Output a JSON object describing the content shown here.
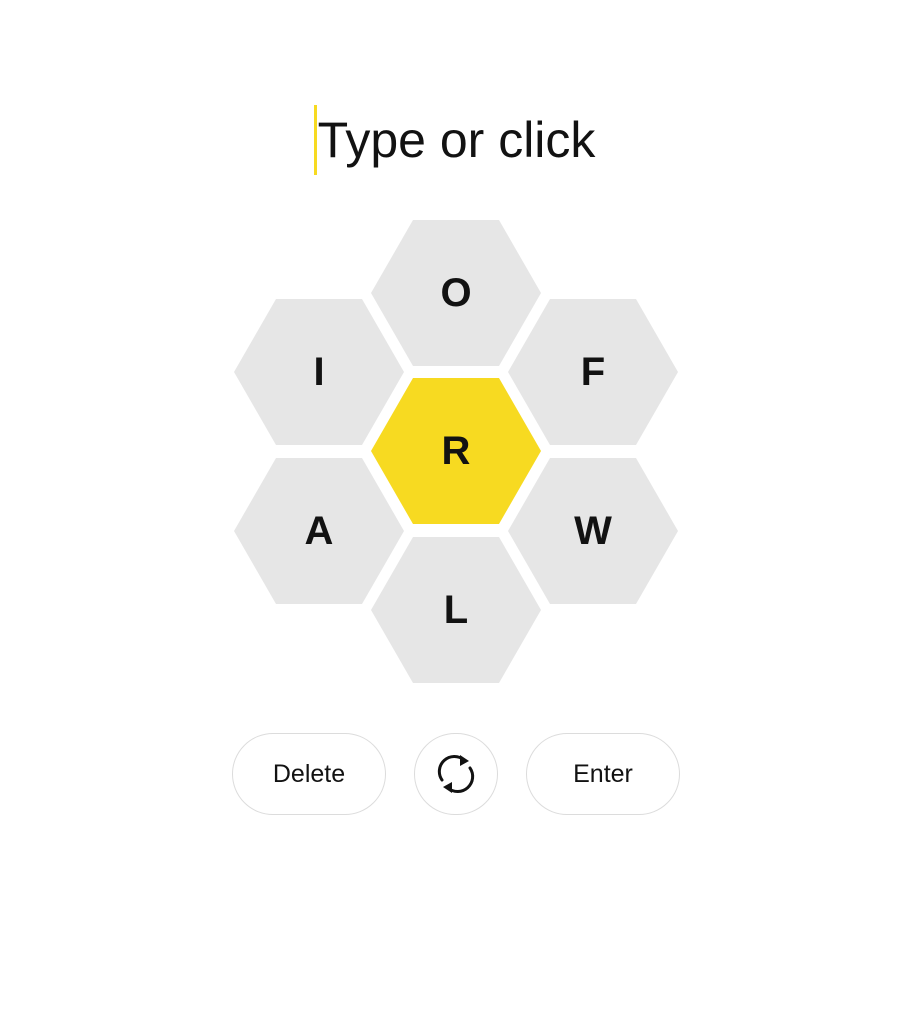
{
  "input": {
    "placeholder": "Type or click",
    "caret_color": "#f7da21"
  },
  "hive": {
    "center_color": "#f7da21",
    "outer_color": "#e6e6e6",
    "letter_color": "#121212",
    "center": {
      "letter": "R"
    },
    "outer": [
      {
        "position": "top",
        "letter": "O"
      },
      {
        "position": "upper-left",
        "letter": "I"
      },
      {
        "position": "upper-right",
        "letter": "F"
      },
      {
        "position": "lower-left",
        "letter": "A"
      },
      {
        "position": "lower-right",
        "letter": "W"
      },
      {
        "position": "bottom",
        "letter": "L"
      }
    ]
  },
  "controls": {
    "delete_label": "Delete",
    "shuffle_icon": "shuffle-icon",
    "enter_label": "Enter"
  }
}
